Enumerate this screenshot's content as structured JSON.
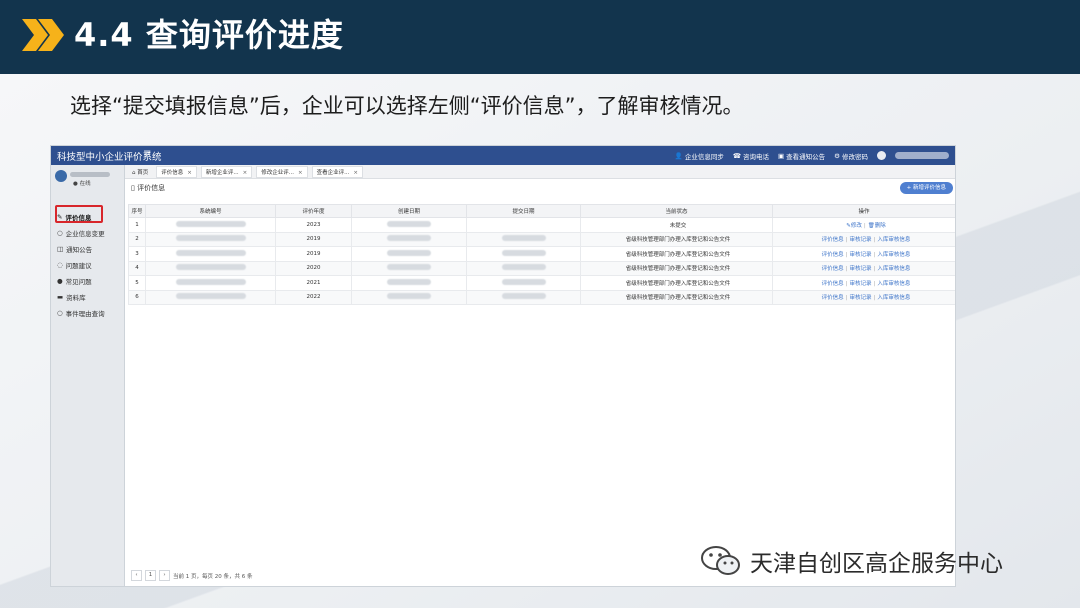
{
  "slide": {
    "title": "4.4 查询评价进度",
    "subtitle": "选择“提交填报信息”后，企业可以选择左侧“评价信息”，了解审核情况。",
    "colors": {
      "header_bg": "#12344d",
      "chevron": "#f6b21a",
      "highlight": "#d8262b",
      "topbar": "#2e4f8f"
    }
  },
  "app": {
    "title": "科技型中小企业评价系统",
    "menu_icon": "hamburger-icon",
    "topbar_links": [
      {
        "icon": "user-icon",
        "label": "企业信息同步"
      },
      {
        "icon": "phone-icon",
        "label": "咨询电话"
      },
      {
        "icon": "notice-icon",
        "label": "查看通知公告"
      },
      {
        "icon": "settings-icon",
        "label": "修改密码"
      }
    ]
  },
  "sidebar": {
    "online": "在线",
    "items": [
      {
        "icon": "edit-icon",
        "label": "评价信息"
      },
      {
        "icon": "circle-icon",
        "label": "企业信息变更"
      },
      {
        "icon": "bell-icon",
        "label": "通知公告"
      },
      {
        "icon": "chat-icon",
        "label": "问题建议"
      },
      {
        "icon": "question-icon",
        "label": "常见问题"
      },
      {
        "icon": "folder-icon",
        "label": "资料库"
      },
      {
        "icon": "circle-icon",
        "label": "事件理由查询"
      }
    ]
  },
  "tabs": [
    {
      "label": "首页"
    },
    {
      "label": "评价信息"
    },
    {
      "label": "新增企业评..."
    },
    {
      "label": "修改企业评..."
    },
    {
      "label": "查看企业评..."
    }
  ],
  "panel": {
    "title": "评价信息",
    "add_button": "+ 新增评价信息"
  },
  "table": {
    "columns": [
      "序号",
      "系统编号",
      "评价年度",
      "创建日期",
      "提交日期",
      "当前状态",
      "操作"
    ],
    "rows": [
      {
        "index": "1",
        "year": "2023",
        "status": "未提交",
        "ops": [
          "修改",
          "删除"
        ]
      },
      {
        "index": "2",
        "year": "2019",
        "status": "省级科技管理部门办理入库登记和公告文件",
        "ops": [
          "评价信息",
          "审核记录",
          "入库审核信息"
        ]
      },
      {
        "index": "3",
        "year": "2019",
        "status": "省级科技管理部门办理入库登记和公告文件",
        "ops": [
          "评价信息",
          "审核记录",
          "入库审核信息"
        ]
      },
      {
        "index": "4",
        "year": "2020",
        "status": "省级科技管理部门办理入库登记和公告文件",
        "ops": [
          "评价信息",
          "审核记录",
          "入库审核信息"
        ]
      },
      {
        "index": "5",
        "year": "2021",
        "status": "省级科技管理部门办理入库登记和公告文件",
        "ops": [
          "评价信息",
          "审核记录",
          "入库审核信息"
        ]
      },
      {
        "index": "6",
        "year": "2022",
        "status": "省级科技管理部门办理入库登记和公告文件",
        "ops": [
          "评价信息",
          "审核记录",
          "入库审核信息"
        ]
      }
    ]
  },
  "pager": {
    "prev": "‹",
    "page": "1",
    "next": "›",
    "summary": "当前 1 页，每页 20 条，共 6 条"
  },
  "watermark": "天津自创区高企服务中心"
}
